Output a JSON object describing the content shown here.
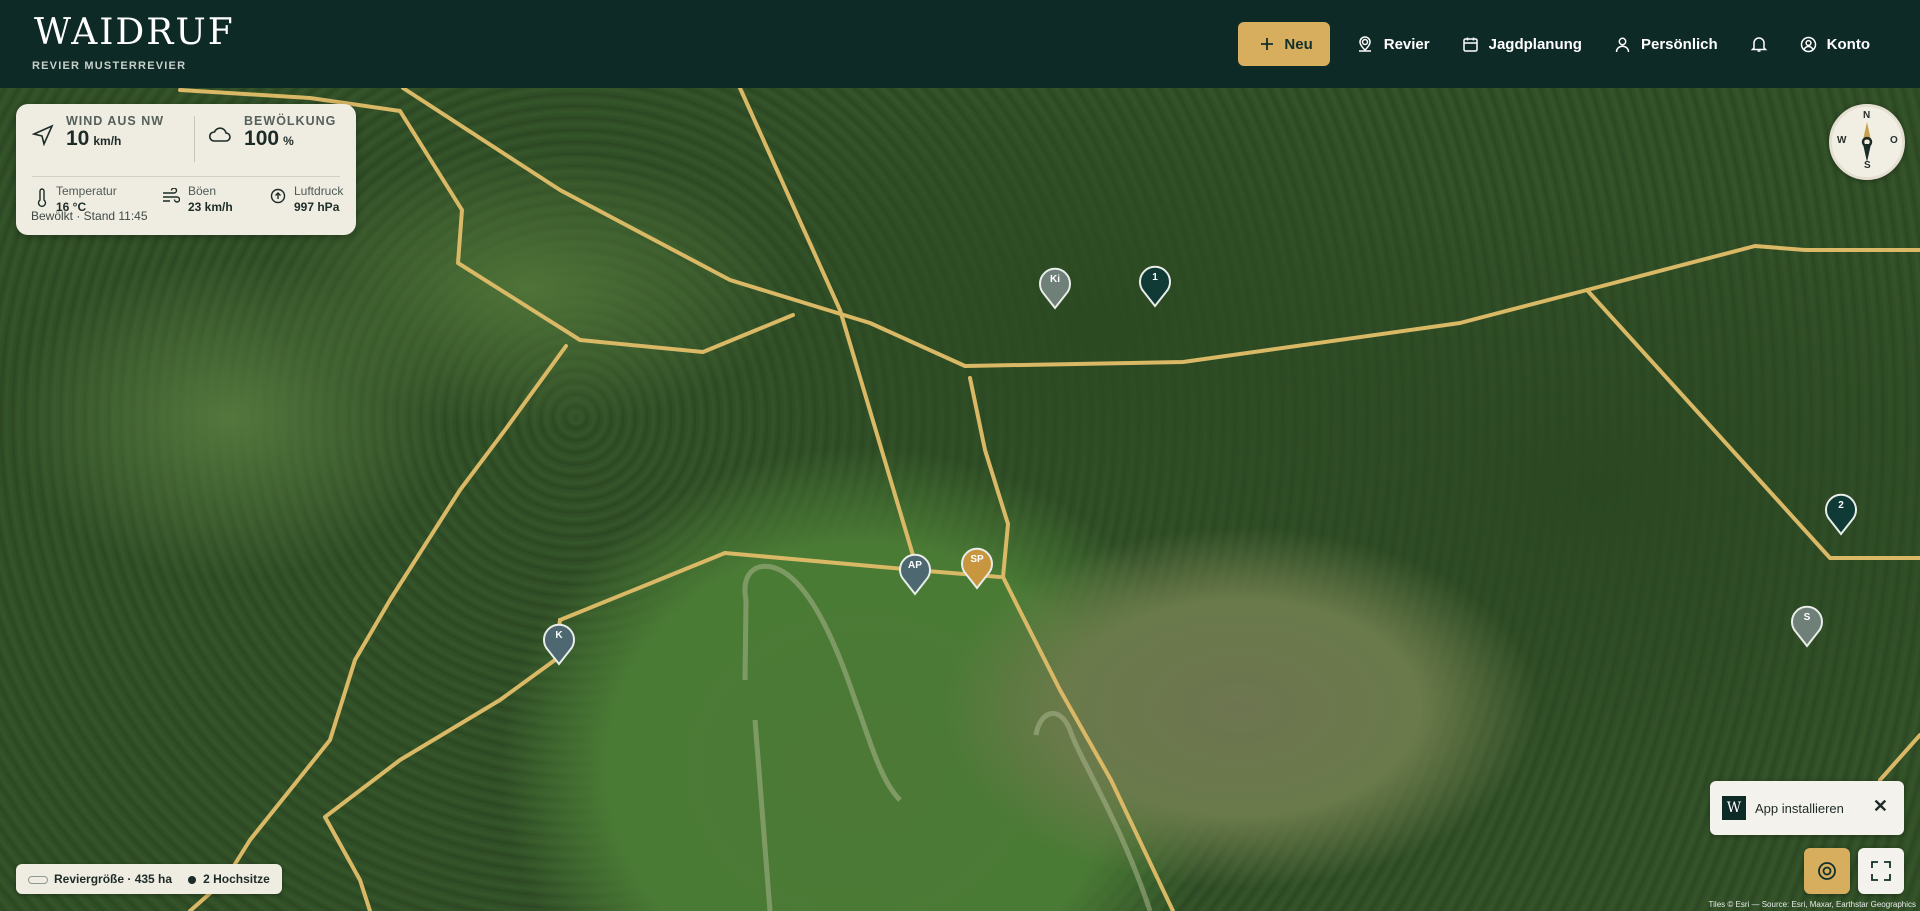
{
  "header": {
    "logo": "WAIDRUF",
    "subtitle": "REVIER MUSTERREVIER",
    "nav": {
      "new_label": "Neu",
      "revier_label": "Revier",
      "jagdplanung_label": "Jagdplanung",
      "persoenlich_label": "Persönlich",
      "konto_label": "Konto"
    }
  },
  "weather": {
    "wind_label": "WIND AUS NW",
    "wind_value": "10",
    "wind_unit": "km/h",
    "cloud_label": "BEWÖLKUNG",
    "cloud_value": "100",
    "cloud_unit": "%",
    "temp_label": "Temperatur",
    "temp_value": "16 °C",
    "gust_label": "Böen",
    "gust_value": "23 km/h",
    "pressure_label": "Luftdruck",
    "pressure_value": "997 hPa",
    "footer": "Bewölkt · Stand 11:45"
  },
  "compass": {
    "n": "N",
    "s": "S",
    "w": "W",
    "o": "O"
  },
  "markers": [
    {
      "label": "Ki",
      "color": "#6f8079"
    },
    {
      "label": "1",
      "color": "#0f3a36"
    },
    {
      "label": "AP",
      "color": "#4d6870"
    },
    {
      "label": "SP",
      "color": "#c8963f"
    },
    {
      "label": "K",
      "color": "#4d6870"
    },
    {
      "label": "2",
      "color": "#0f3a36"
    },
    {
      "label": "S",
      "color": "#6f8079"
    }
  ],
  "legend": {
    "area": "Reviergröße · 435 ha",
    "stands": "2 Hochsitze"
  },
  "install": {
    "label": "App installieren",
    "mark": "W"
  },
  "attribution": "Tiles © Esri — Source: Esri, Maxar, Earthstar Geographics",
  "colors": {
    "header_bg": "#0e2a26",
    "accent": "#d7ad5e",
    "boundary": "#d9b866"
  }
}
